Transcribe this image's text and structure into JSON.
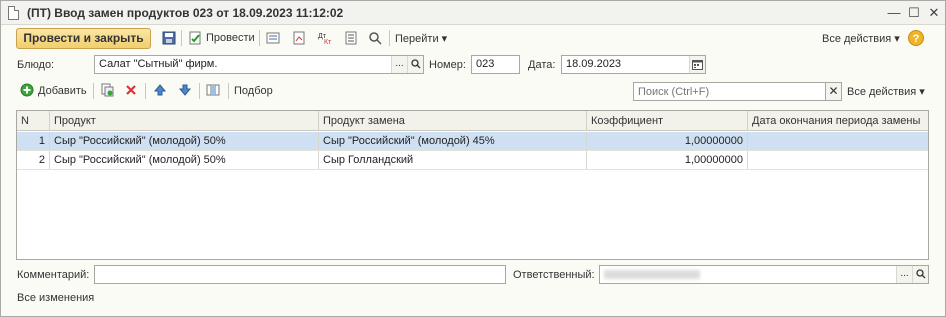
{
  "window": {
    "title": "(ПТ) Ввод замен продуктов 023 от 18.09.2023 11:12:02",
    "minimize": "—",
    "maximize": "☐",
    "close": "✕"
  },
  "toolbar": {
    "post_and_close": "Провести и закрыть",
    "post": "Провести",
    "go_to": "Перейти ▾",
    "all_actions": "Все действия ▾",
    "help": "?"
  },
  "header_fields": {
    "dish_label": "Блюдо:",
    "dish_value": "Салат \"Сытный\" фирм.",
    "number_label": "Номер:",
    "number_value": "023",
    "date_label": "Дата:",
    "date_value": "18.09.2023"
  },
  "table_toolbar": {
    "add": "Добавить",
    "selection": "Подбор",
    "search_placeholder": "Поиск (Ctrl+F)",
    "all_actions": "Все действия ▾"
  },
  "table": {
    "columns": [
      "N",
      "Продукт",
      "Продукт замена",
      "Коэффициент",
      "Дата окончания периода замены"
    ],
    "rows": [
      {
        "n": "1",
        "product": "Сыр \"Российский\" (молодой) 50%",
        "replacement": "Сыр \"Российский\" (молодой) 45%",
        "coefficient": "1,00000000",
        "end_date": ""
      },
      {
        "n": "2",
        "product": "Сыр \"Российский\" (молодой) 50%",
        "replacement": "Сыр Голландский",
        "coefficient": "1,00000000",
        "end_date": ""
      }
    ]
  },
  "footer": {
    "comment_label": "Комментарий:",
    "comment_value": "",
    "responsible_label": "Ответственный:",
    "all_changes": "Все изменения"
  },
  "colors": {
    "primary_button": "#f1cf6e",
    "selected_row": "#cfe0f2",
    "help_icon": "#f0b429"
  }
}
